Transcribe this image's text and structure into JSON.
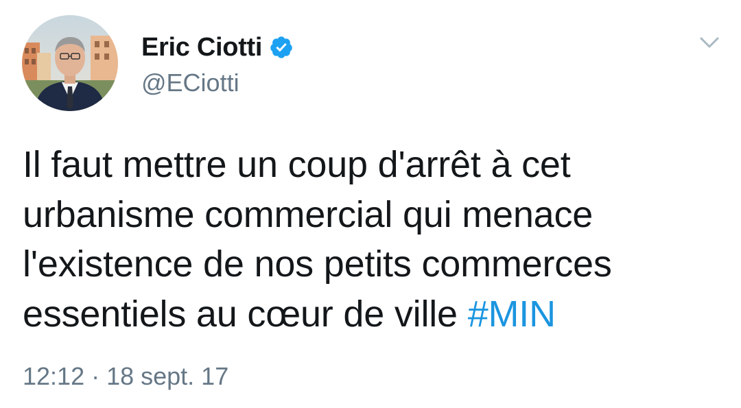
{
  "author": {
    "display_name": "Eric Ciotti",
    "handle": "@ECiotti",
    "verified": true
  },
  "tweet": {
    "lines": [
      "Il faut mettre un coup d'arrêt à cet",
      "urbanisme commercial qui menace",
      "l'existence de nos petits commerces",
      "essentiels au cœur de ville "
    ],
    "hashtag": "#MIN",
    "timestamp": "12:12 · 18 sept. 17"
  },
  "icons": {
    "verified": "verified-badge-icon",
    "menu": "chevron-down-icon"
  },
  "colors": {
    "text": "#14171a",
    "secondary": "#657786",
    "link": "#1b95e0",
    "verified": "#1da1f2",
    "background": "#ffffff"
  }
}
